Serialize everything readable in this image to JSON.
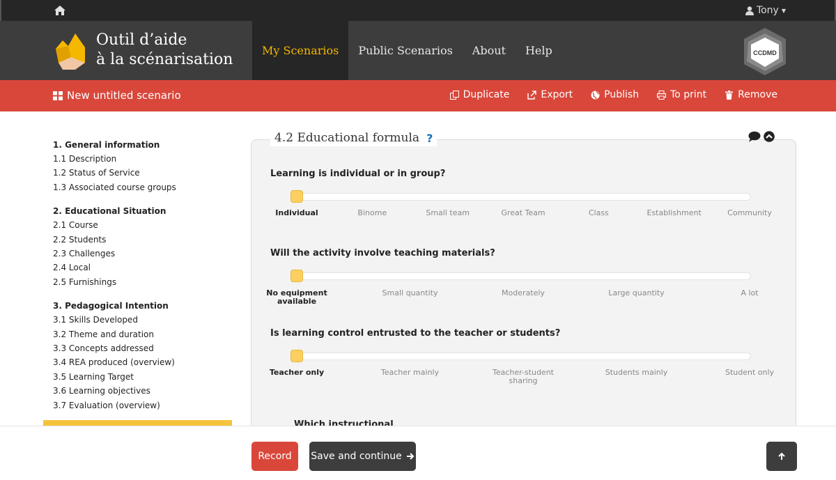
{
  "topbar": {
    "home_icon": "home-icon",
    "user_name": "Tony",
    "user_icon": "user-icon"
  },
  "brand": {
    "line1": "Outil d’aide",
    "line2": "à la scénarisation",
    "badge": "CCDMD"
  },
  "nav": [
    {
      "label": "My Scenarios",
      "active": true
    },
    {
      "label": "Public Scenarios",
      "active": false
    },
    {
      "label": "About",
      "active": false
    },
    {
      "label": "Help",
      "active": false
    }
  ],
  "toolbar": {
    "scenario_title": "New untitled scenario",
    "actions": [
      {
        "label": "Duplicate",
        "icon": "duplicate-icon"
      },
      {
        "label": "Export",
        "icon": "export-icon"
      },
      {
        "label": "Publish",
        "icon": "globe-icon"
      },
      {
        "label": "To print",
        "icon": "print-icon"
      },
      {
        "label": "Remove",
        "icon": "trash-icon"
      }
    ]
  },
  "sidebar": {
    "groups": [
      {
        "heading": "1. General information",
        "items": [
          "1.1 Description",
          "1.2 Status of Service",
          "1.3 Associated course groups"
        ]
      },
      {
        "heading": "2. Educational Situation",
        "items": [
          "2.1 Course",
          "2.2 Students",
          "2.3 Challenges",
          "2.4 Local",
          "2.5 Furnishings"
        ]
      },
      {
        "heading": "3. Pedagogical Intention",
        "items": [
          "3.1 Skills Developed",
          "3.2 Theme and duration",
          "3.3 Concepts addressed",
          "3.4 REA produced (overview)",
          "3.5 Learning Target",
          "3.6 Learning objectives",
          "3.7 Evaluation (overview)"
        ]
      }
    ]
  },
  "panel": {
    "title": "4.2 Educational formula",
    "help": "?",
    "questions": [
      {
        "label": "Learning is individual or in group?",
        "options": [
          "Individual",
          "Binome",
          "Small team",
          "Great Team",
          "Class",
          "Establishment",
          "Community"
        ],
        "selected": 0
      },
      {
        "label": "Will the activity involve teaching materials?",
        "options": [
          "No equipment available",
          "Small quantity",
          "Moderately",
          "Large quantity",
          "A lot"
        ],
        "selected": 0
      },
      {
        "label": "Is learning control entrusted to the teacher or students?",
        "options": [
          "Teacher only",
          "Teacher mainly",
          "Teacher-student sharing",
          "Students mainly",
          "Student only"
        ],
        "selected": 0
      }
    ],
    "next_question": "Which instructional"
  },
  "footer": {
    "record": "Record",
    "save": "Save and continue"
  }
}
